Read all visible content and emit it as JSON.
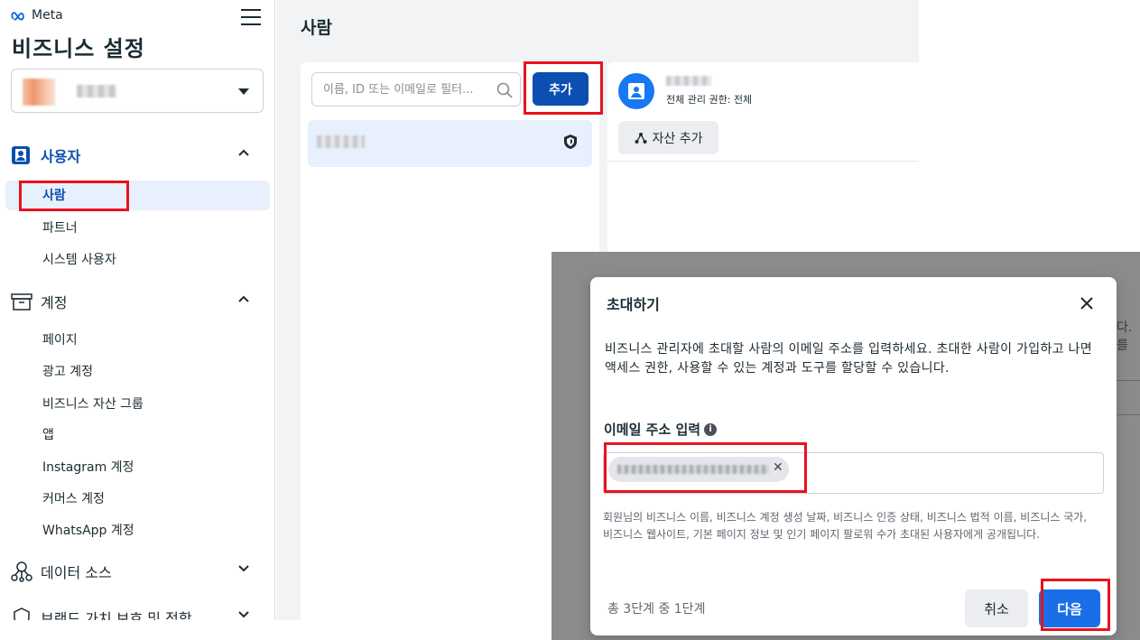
{
  "colors": {
    "accent": "#0a4fb1",
    "highlight": "#e8131d",
    "primary_button": "#1a6fe8",
    "active_bg": "#e7f0fc"
  },
  "sidebar": {
    "brand": "Meta",
    "title": "비즈니스 설정",
    "sections": [
      {
        "label": "사용자",
        "icon": "users-icon",
        "expanded": true,
        "items": [
          "사람",
          "파트너",
          "시스템 사용자"
        ]
      },
      {
        "label": "계정",
        "icon": "archive-icon",
        "expanded": true,
        "items": [
          "페이지",
          "광고 계정",
          "비즈니스 자산 그룹",
          "앱",
          "Instagram 계정",
          "커머스 계정",
          "WhatsApp 계정"
        ]
      },
      {
        "label": "데이터 소스",
        "icon": "data-sources-icon",
        "expanded": false,
        "items": []
      },
      {
        "label": "브랜드 가치 보호 및 적합",
        "icon": "shield-icon",
        "expanded": false,
        "items": []
      }
    ],
    "active_item": "사람"
  },
  "main": {
    "title": "사람",
    "search": {
      "placeholder": "이름, ID 또는 이메일로 필터..."
    },
    "add_label": "추가",
    "detail": {
      "role": "전체 관리 권한: 전체",
      "asset_button": "자산 추가"
    }
  },
  "dialog": {
    "title": "초대하기",
    "description": "비즈니스 관리자에 초대할 사람의 이메일 주소를 입력하세요. 초대한 사람이 가입하고 나면 액세스 권한, 사용할 수 있는 계정과 도구를 할당할 수 있습니다.",
    "field_label": "이메일 주소 입력",
    "note": "회원님의 비즈니스 이름, 비즈니스 계정 생성 날짜, 비즈니스 인증 상태, 비즈니스 법적 이름, 비즈니스 국가, 비즈니스 웹사이트, 기본 페이지 정보 및 인기 페이지 팔로워 수가 초대된 사용자에게 공개됩니다.",
    "step": "총 3단계 중 1단계",
    "cancel": "취소",
    "next": "다음"
  },
  "overlay_text": "다. 를"
}
